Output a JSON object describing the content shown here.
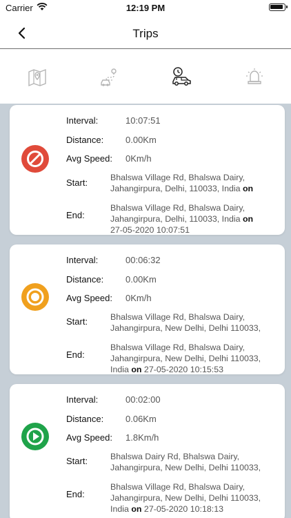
{
  "status_bar": {
    "carrier": "Carrier",
    "time": "12:19 PM"
  },
  "nav": {
    "title": "Trips"
  },
  "tabs": [
    {
      "icon": "map-icon"
    },
    {
      "icon": "route-icon"
    },
    {
      "icon": "car-clock-icon",
      "active": true
    },
    {
      "icon": "alarm-bell-icon"
    }
  ],
  "labels": {
    "interval": "Interval:",
    "distance": "Distance:",
    "avg_speed": "Avg Speed:",
    "start": "Start:",
    "end": "End:",
    "on": "on"
  },
  "trips": [
    {
      "status": "stopped",
      "status_color": "#e04a3a",
      "interval": "10:07:51",
      "distance": "0.00Km",
      "avg_speed": "0Km/h",
      "start_line1": "Bhalswa Village Rd, Bhalswa Dairy,",
      "start_line2": "Jahangirpura, Delhi, 110033, India",
      "start_on": "on",
      "end_line1": "Bhalswa Village Rd, Bhalswa Dairy,",
      "end_line2": "Jahangirpura, Delhi, 110033, India",
      "end_on": "on",
      "end_time": "27-05-2020 10:07:51"
    },
    {
      "status": "idle",
      "status_color": "#f0a01e",
      "interval": "00:06:32",
      "distance": "0.00Km",
      "avg_speed": "0Km/h",
      "start_line1": "Bhalswa Village Rd, Bhalswa Dairy,",
      "start_line2": "Jahangirpura, New Delhi, Delhi 110033,",
      "end_line1": "Bhalswa Village Rd, Bhalswa Dairy,",
      "end_line2": "Jahangirpura, New Delhi, Delhi 110033,",
      "end_line3_pre": "India",
      "end_on": "on",
      "end_time": "27-05-2020 10:15:53"
    },
    {
      "status": "moving",
      "status_color": "#1fa34a",
      "interval": "00:02:00",
      "distance": "0.06Km",
      "avg_speed": "1.8Km/h",
      "start_line1": "Bhalswa Dairy Rd, Bhalswa Dairy,",
      "start_line2": "Jahangirpura, New Delhi, Delhi 110033,",
      "end_line1": "Bhalswa Village Rd, Bhalswa Dairy,",
      "end_line2": "Jahangirpura, New Delhi, Delhi 110033,",
      "end_line3_pre": "India",
      "end_on": "on",
      "end_time": "27-05-2020 10:18:13"
    }
  ]
}
